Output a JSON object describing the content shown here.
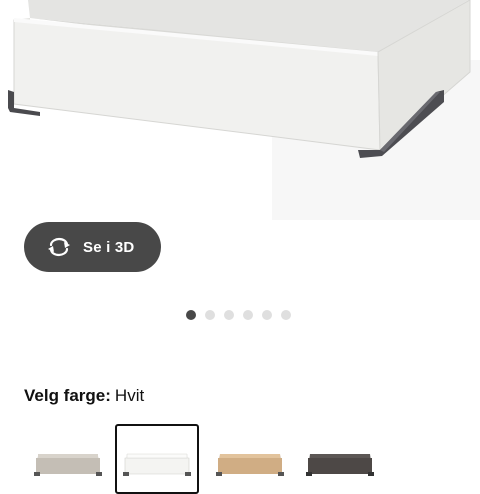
{
  "view3d": {
    "label": "Se i 3D",
    "icon": "rotate-3d-icon"
  },
  "gallery": {
    "image_count": 6,
    "active_index": 0
  },
  "color": {
    "label": "Velg farge:",
    "selected": "Hvit"
  },
  "swatches": [
    {
      "icon": "drawer-beige-swatch-icon",
      "color": "#bdb7ae",
      "selected": false
    },
    {
      "icon": "drawer-white-swatch-icon",
      "color": "#f3f3f1",
      "selected": true
    },
    {
      "icon": "drawer-oak-swatch-icon",
      "color": "#c9a47c",
      "selected": false
    },
    {
      "icon": "drawer-dark-grey-swatch-icon",
      "color": "#4a4644",
      "selected": false
    }
  ],
  "colors": {
    "button_bg": "#484848",
    "dot_active": "#484848",
    "dot_inactive": "#dfdfdf",
    "text": "#111111"
  }
}
